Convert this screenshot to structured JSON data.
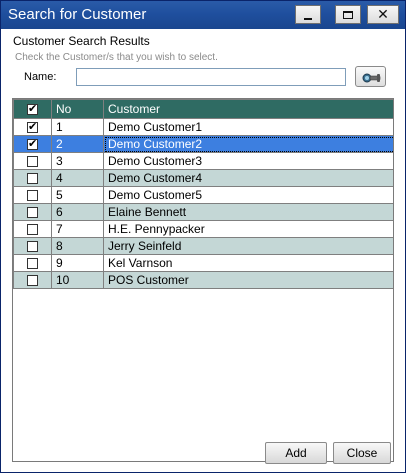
{
  "window": {
    "title": "Search for Customer"
  },
  "header": {
    "section_title": "Customer Search Results",
    "hint": "Check the Customer/s that you wish to select.",
    "name_label": "Name:",
    "name_value": ""
  },
  "grid": {
    "columns": [
      "",
      "No",
      "Customer"
    ],
    "header_checked": true,
    "rows": [
      {
        "no": "1",
        "name": "Demo Customer1",
        "checked": true
      },
      {
        "no": "2",
        "name": "Demo Customer2",
        "checked": true,
        "selected": true
      },
      {
        "no": "3",
        "name": "Demo Customer3",
        "checked": false
      },
      {
        "no": "4",
        "name": "Demo Customer4",
        "checked": false
      },
      {
        "no": "5",
        "name": "Demo Customer5",
        "checked": false
      },
      {
        "no": "6",
        "name": "Elaine Bennett",
        "checked": false
      },
      {
        "no": "7",
        "name": "H.E. Pennypacker",
        "checked": false
      },
      {
        "no": "8",
        "name": "Jerry Seinfeld",
        "checked": false
      },
      {
        "no": "9",
        "name": "Kel Varnson",
        "checked": false
      },
      {
        "no": "10",
        "name": "POS Customer",
        "checked": false
      }
    ]
  },
  "buttons": {
    "add": "Add",
    "close": "Close"
  },
  "icons": {
    "search": "binoculars-icon",
    "minimize": "minimize-icon",
    "maximize": "maximize-icon",
    "close": "close-icon"
  },
  "colors": {
    "titlebar": "#1f4f9e",
    "grid_header": "#2f6b63",
    "row_alt": "#c4d7d6",
    "row_selected": "#3d7fe0"
  }
}
